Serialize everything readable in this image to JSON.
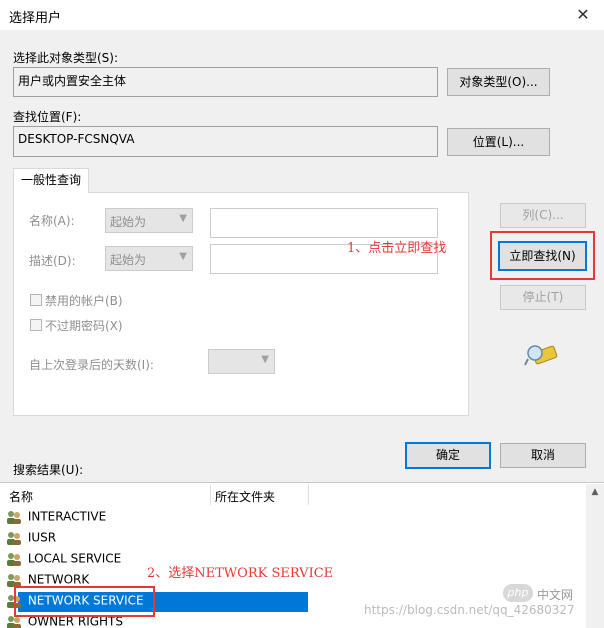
{
  "window": {
    "title": "选择用户",
    "close_glyph": "✕"
  },
  "object_type": {
    "label": "选择此对象类型(S):",
    "value": "用户或内置安全主体",
    "button": "对象类型(O)..."
  },
  "location": {
    "label": "查找位置(F):",
    "value": "DESKTOP-FCSNQVA",
    "button": "位置(L)..."
  },
  "query": {
    "tab_label": "一般性查询",
    "name_label": "名称(A):",
    "name_mode": "起始为",
    "desc_label": "描述(D):",
    "desc_mode": "起始为",
    "disabled_accounts": "禁用的帐户(B)",
    "non_expiring_pw": "不过期密码(X)",
    "days_since_logon": "自上次登录后的天数(I):"
  },
  "side_buttons": {
    "columns": "列(C)...",
    "find_now": "立即查找(N)",
    "stop": "停止(T)"
  },
  "dialog_buttons": {
    "ok": "确定",
    "cancel": "取消"
  },
  "results": {
    "label": "搜索结果(U):",
    "columns": [
      "名称",
      "所在文件夹"
    ],
    "rows": [
      {
        "name": "INTERACTIVE",
        "selected": false
      },
      {
        "name": "IUSR",
        "selected": false
      },
      {
        "name": "LOCAL SERVICE",
        "selected": false
      },
      {
        "name": "NETWORK",
        "selected": false
      },
      {
        "name": "NETWORK SERVICE",
        "selected": true
      },
      {
        "name": "OWNER RIGHTS",
        "selected": false
      }
    ]
  },
  "annotations": {
    "step1": "1、点击立即查找",
    "step2": "2、选择NETWORK SERVICE"
  },
  "watermark": {
    "logo": "php",
    "site": "中文网",
    "url": "https://blog.csdn.net/qq_42680327"
  },
  "colors": {
    "accent": "#0078d7",
    "annotation": "#e53935"
  },
  "icons": {
    "user_group": "user-group-icon",
    "search_flashlight": "flashlight-search-icon"
  }
}
